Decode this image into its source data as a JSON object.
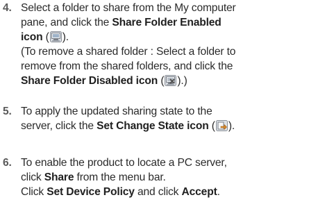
{
  "steps": [
    {
      "number": "4.",
      "lines": [
        {
          "t1": "Select a folder to share from the My computer"
        },
        {
          "t1": "pane, and click the ",
          "b1": "Share Folder Enabled"
        },
        {
          "b1": "icon",
          "t1": " (",
          "icon": "share-folder-enabled-icon",
          "t2": ")."
        }
      ],
      "note_lines": [
        {
          "t1": "(To remove a shared folder : Select a folder to"
        },
        {
          "t1": "remove from the shared folders, and click the"
        },
        {
          "b1": "Share Folder Disabled icon",
          "t1": " (",
          "icon": "share-folder-disabled-icon",
          "t2": ").)"
        }
      ]
    },
    {
      "number": "5.",
      "lines": [
        {
          "t1": "To apply the updated sharing state to the"
        },
        {
          "t1": "server, click the ",
          "b1": "Set Change State icon",
          "t2": " (",
          "icon": "set-change-state-icon",
          "t3": ")."
        }
      ]
    },
    {
      "number": "6.",
      "lines": [
        {
          "t1": "To enable the product to locate a PC server,"
        },
        {
          "t1": "click ",
          "b1": "Share",
          "t2": " from the menu bar."
        },
        {
          "t1": "Click ",
          "b1": "Set Device Policy",
          "t2": " and click ",
          "b2": "Accept",
          "t3": "."
        }
      ]
    }
  ]
}
